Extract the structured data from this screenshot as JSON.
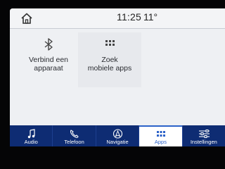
{
  "status": {
    "home_icon": "home-icon",
    "time": "11:25",
    "temperature": "11°"
  },
  "tiles": [
    {
      "icon": "bluetooth-icon",
      "label_line1": "Verbind een",
      "label_line2": "apparaat"
    },
    {
      "icon": "apps-grid-icon",
      "label_line1": "Zoek",
      "label_line2": "mobiele apps"
    }
  ],
  "nav": {
    "items": [
      {
        "label": "Audio",
        "icon": "music-note-icon"
      },
      {
        "label": "Telefoon",
        "icon": "phone-icon"
      },
      {
        "label": "Navigatie",
        "icon": "navigation-icon"
      },
      {
        "label": "Apps",
        "icon": "apps-grid-icon",
        "active": true
      },
      {
        "label": "Instellingen",
        "icon": "settings-sliders-icon"
      }
    ],
    "active_color": "#2c62c8",
    "bar_color": "#0e2c73"
  }
}
